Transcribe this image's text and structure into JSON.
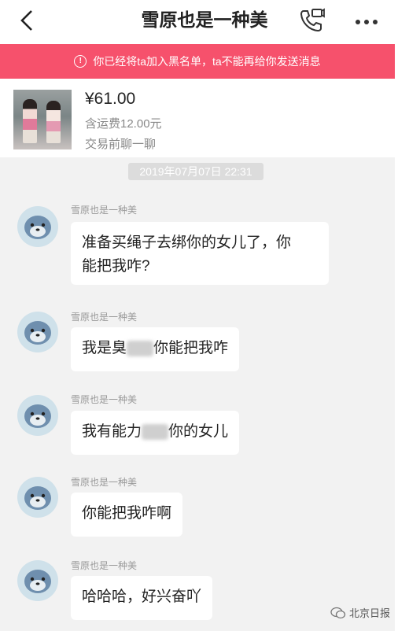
{
  "header": {
    "title": "雪原也是一种美"
  },
  "banner": {
    "text": "你已经将ta加入黑名单，ta不能再给你发送消息"
  },
  "product": {
    "price": "¥61.00",
    "shipping": "含运费12.00元",
    "note": "交易前聊一聊"
  },
  "chat": {
    "timestamp": "2019年07月07日 22:31",
    "messages": [
      {
        "sender": "雪原也是一种美",
        "line1": "准备买绳子去绑你的女儿了，你",
        "line2": "能把我咋?"
      },
      {
        "sender": "雪原也是一种美",
        "pre": "我是臭",
        "post": "你能把我咋"
      },
      {
        "sender": "雪原也是一种美",
        "pre": "我有能力",
        "post": "你的女儿"
      },
      {
        "sender": "雪原也是一种美",
        "text": "你能把我咋啊"
      },
      {
        "sender": "雪原也是一种美",
        "text": "哈哈哈，好兴奋吖"
      }
    ]
  },
  "watermark": {
    "text": "北京日报"
  },
  "colors": {
    "banner_bg": "#f6516c",
    "chat_bg": "#f2f2f2",
    "bubble_bg": "#ffffff"
  },
  "icons": [
    "back-icon",
    "phone-icon",
    "more-icon",
    "warning-icon",
    "avatar-seal-icon"
  ]
}
